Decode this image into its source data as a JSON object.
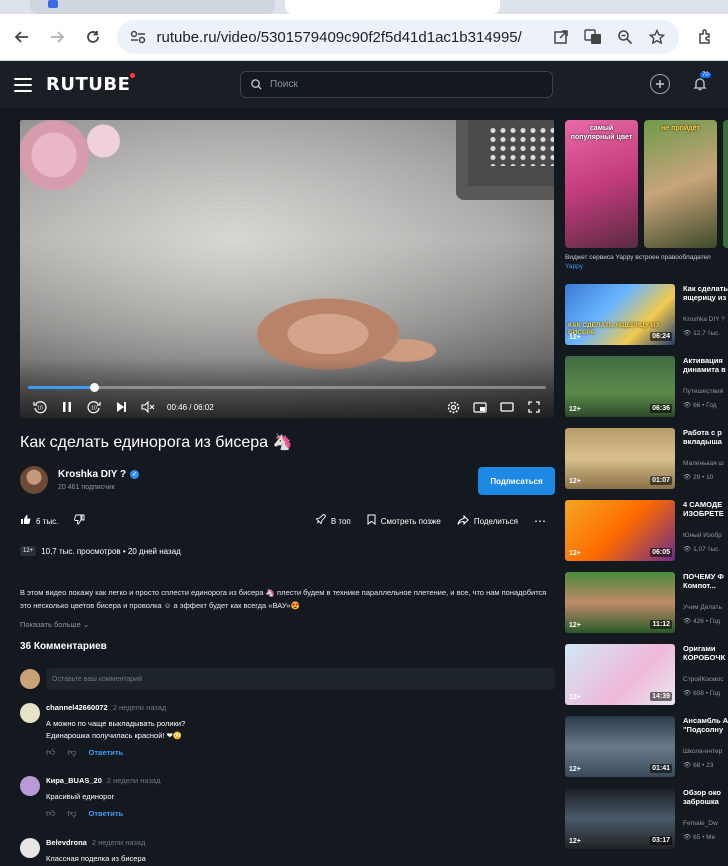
{
  "browser": {
    "url": "rutube.ru/video/5301579409c90f2f5d41d1ac1b314995/"
  },
  "header": {
    "logo": "RUTUBE",
    "search_placeholder": "Поиск",
    "notifications_badge": "70"
  },
  "player": {
    "time": "00:46 / 06:02",
    "progress": 0.127,
    "skip_back": "10",
    "skip_forward": "10"
  },
  "video": {
    "title": "Как сделать единорога из бисера 🦄",
    "channel_name": "Kroshka DIY ?",
    "subscribers": "20 461 подписчик",
    "subscribe_label": "Подписаться",
    "likes": "6 тыс.",
    "top_label": "В топ",
    "watch_later_label": "Смотреть позже",
    "share_label": "Поделиться",
    "age_rating": "12+",
    "views_and_date": "10,7 тыс. просмотров • 20 дней назад",
    "description": "В этом видео покажу как легко и просто сплести единорога из бисера 🦄 плести будем в технике параллельное плетение, и все, что нам понадобится это несколько цветов бисера и проволка ☺ а эффект будет как всегда «ВАУ»😍",
    "show_more": "Показать больше"
  },
  "comments": {
    "title": "36 Комментариев",
    "input_placeholder": "Оставьте ваш комментарий",
    "reply_label": "Ответить",
    "items": [
      {
        "author": "channel42660072",
        "when": "2 недели назад",
        "text1": "А можно по чаще выкладывать ролики?",
        "text2": "Единарошка получилась красной! ❤😳"
      },
      {
        "author": "Кира_BUAS_20",
        "when": "2 недели назад",
        "text1": "Красивый единорог",
        "text2": ""
      },
      {
        "author": "Belevdrona",
        "when": "2 недели назад",
        "text1": "Классная поделка из бисера",
        "text2": ""
      }
    ]
  },
  "sidebar": {
    "yappy_cards": [
      {
        "label": "самый популярный цвет"
      },
      {
        "label": "не пройдёт"
      }
    ],
    "yappy_note": "Виджет сервиса Yappy встроен правообладател",
    "yappy_brand": "Yappy",
    "recommendations": [
      {
        "title1": "Как сделать",
        "title2": "ящерицу из",
        "author": "Kroshka DIY ?",
        "meta": "12,7 тыс.",
        "age": "12+",
        "duration": "06:24",
        "overlay": "КАК СДЕЛАТЬ ЯЩЕРИЦУ ИЗ БИСЕРА"
      },
      {
        "title1": "Активация",
        "title2": "динамита в",
        "author": "Путешествия",
        "meta": "66 • Год",
        "age": "12+",
        "duration": "06:36",
        "overlay": ""
      },
      {
        "title1": "Работа с р",
        "title2": "вкладыша",
        "author": "Маленькая ш",
        "meta": "29 • 10",
        "age": "12+",
        "duration": "01:07",
        "overlay": ""
      },
      {
        "title1": "4 САМОДЕ",
        "title2": "ИЗОБРЕТЕ",
        "author": "Юный Изобр",
        "meta": "1,07 тыс.",
        "age": "12+",
        "duration": "06:05",
        "overlay": ""
      },
      {
        "title1": "ПОЧЕМУ Ф",
        "title2": "Компот...",
        "author": "Учим Делать",
        "meta": "426 • Год",
        "age": "12+",
        "duration": "11:12",
        "overlay": ""
      },
      {
        "title1": "Оригами",
        "title2": "КОРОБОЧК",
        "author": "СтройКосмос",
        "meta": "608 • Год",
        "age": "12+",
        "duration": "14:39",
        "overlay": ""
      },
      {
        "title1": "Ансамбль А",
        "title2": "\"Подсолну",
        "author": "Школа-интер",
        "meta": "68 • 23",
        "age": "12+",
        "duration": "01:41",
        "overlay": ""
      },
      {
        "title1": "Обзор око",
        "title2": "заброшка",
        "author": "Female_Dw",
        "meta": "65 • Ме",
        "age": "12+",
        "duration": "03:17",
        "overlay": ""
      }
    ]
  },
  "colors": {
    "accent": "#1e88e5",
    "progress": "#3d9cf5",
    "background": "#14191f"
  }
}
